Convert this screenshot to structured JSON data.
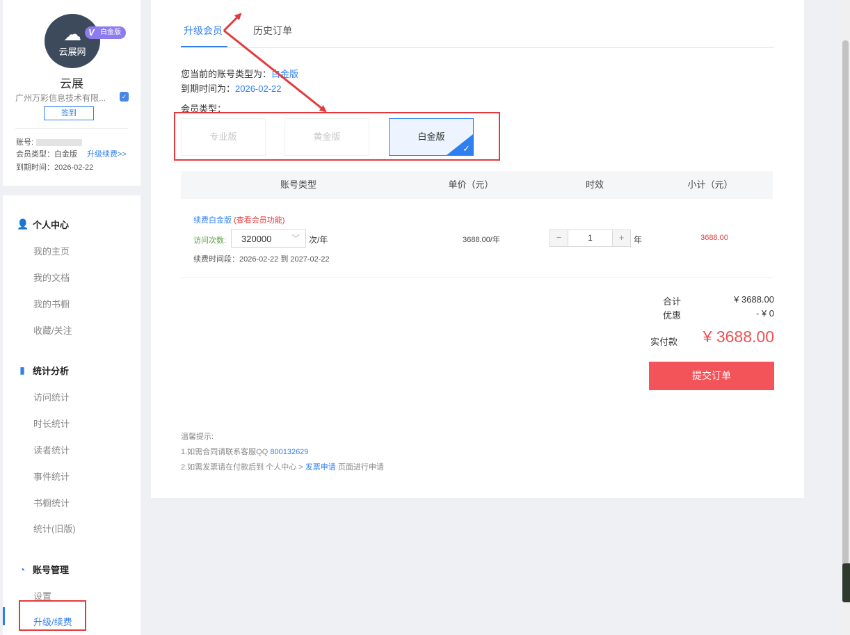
{
  "profile": {
    "avatar_brand": "云展网",
    "vip_badge": "白金版",
    "vip_badge_v": "V",
    "name": "云展",
    "company": "广州万彩信息技术有限...",
    "checkin_label": "签到",
    "account_label": "账号:",
    "member_type": "会员类型：白金版",
    "upgrade_link": "升级续费>>",
    "expire": "到期时间：2026-02-22"
  },
  "nav": {
    "personal_center": "个人中心",
    "personal_items": [
      "我的主页",
      "我的文档",
      "我的书橱",
      "收藏/关注"
    ],
    "stats": "统计分析",
    "stats_items": [
      "访问统计",
      "时长统计",
      "读者统计",
      "事件统计",
      "书橱统计",
      "统计(旧版)"
    ],
    "account": "账号管理",
    "account_items": [
      "设置",
      "升级/续费"
    ]
  },
  "tabs": [
    "升级会员",
    "历史订单"
  ],
  "account_info": {
    "type_prefix": "您当前的账号类型为：",
    "type_value": "白金版",
    "expire_prefix": "到期时间为：",
    "expire_value": "2026-02-22",
    "member_type_label": "会员类型："
  },
  "plans": [
    "专业版",
    "黄金版",
    "白金版"
  ],
  "table": {
    "headers": [
      "账号类型",
      "单价（元）",
      "时效",
      "小计（元）"
    ],
    "renew_title": "续费白金版",
    "renew_sub": "(查看会员功能)",
    "visits_label": "访问次数:",
    "visits_value": "320000",
    "visits_unit": "次/年",
    "renew_period": "续费时间段：2026-02-22 到 2027-02-22",
    "unit_price": "3688.00/年",
    "qty": "1",
    "qty_unit": "年",
    "minus": "−",
    "plus": "+",
    "subtotal": "3688.00"
  },
  "summary": {
    "total_label": "合计",
    "total_value": "¥ 3688.00",
    "discount_label": "优惠",
    "discount_value": "- ¥ 0",
    "pay_label": "实付款",
    "pay_value": "¥ 3688.00",
    "submit": "提交订单"
  },
  "tips": {
    "title": "温馨提示:",
    "tip1_prefix": "1.如需合同请联系客服QQ",
    "tip1_qq": "800132629",
    "tip2_prefix": "2.如需发票请在付款后到 个人中心 >",
    "tip2_link": "发票申请",
    "tip2_suffix": "页面进行申请"
  },
  "colors": {
    "accent": "#2f7ff0",
    "danger": "#f25459",
    "annotation": "#e4393c"
  }
}
